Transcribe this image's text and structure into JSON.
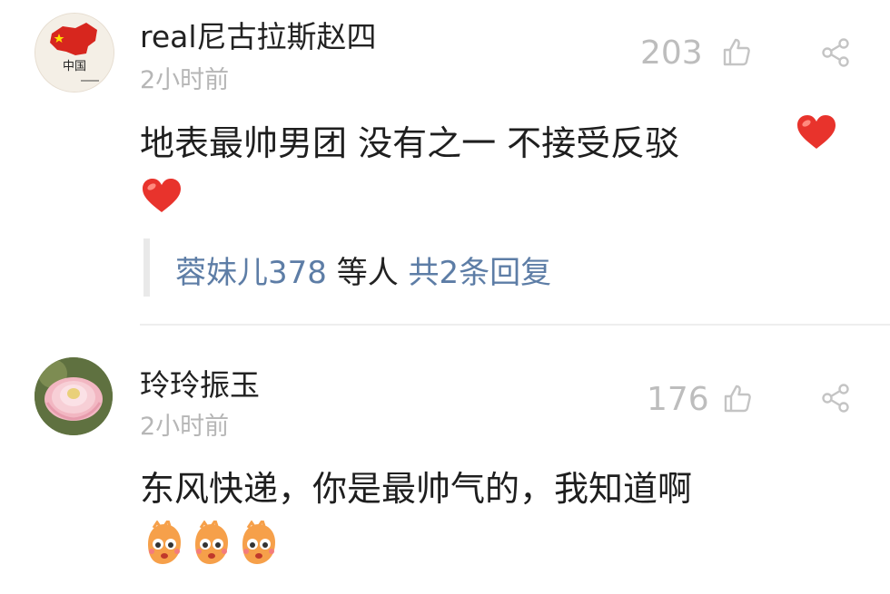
{
  "comments": [
    {
      "username": "real尼古拉斯赵四",
      "time": "2小时前",
      "likes": "203",
      "text": "地表最帅男团 没有之一 不接受反驳",
      "avatar_text": "中国",
      "replies": {
        "users": "蓉妹儿378",
        "middle": " 等人 ",
        "count": "共2条回复"
      }
    },
    {
      "username": "玲玲振玉",
      "time": "2小时前",
      "likes": "176",
      "text": "东风快递，你是最帅气的，我知道啊"
    }
  ],
  "icons": {
    "like": "thumbs-up-outline",
    "share": "share-nodes",
    "heart": "red-heart-emoji",
    "face": "orange-face-emoji"
  },
  "colors": {
    "link": "#5d7da6",
    "muted": "#b6b6b6",
    "heart": "#e8332c"
  }
}
